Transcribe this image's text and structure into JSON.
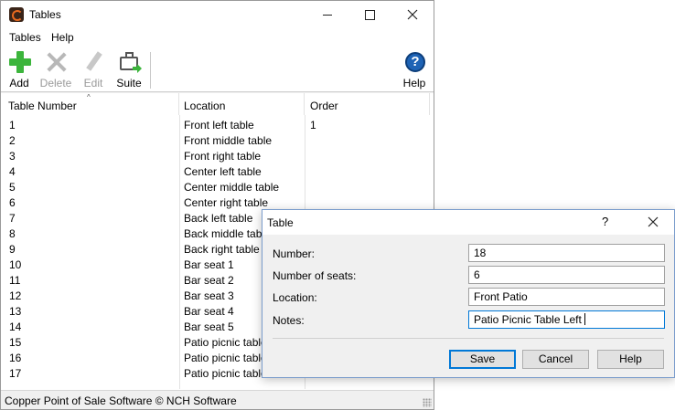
{
  "window": {
    "title": "Tables",
    "menu": [
      "Tables",
      "Help"
    ],
    "toolbar": {
      "add": "Add",
      "delete": "Delete",
      "edit": "Edit",
      "suite": "Suite",
      "help": "Help"
    },
    "columns": [
      "Table Number",
      "Location",
      "Order"
    ],
    "rows": [
      {
        "number": "1",
        "location": "Front left table",
        "order": "1"
      },
      {
        "number": "2",
        "location": "Front middle table",
        "order": ""
      },
      {
        "number": "3",
        "location": "Front right table",
        "order": ""
      },
      {
        "number": "4",
        "location": "Center left table",
        "order": ""
      },
      {
        "number": "5",
        "location": "Center middle table",
        "order": ""
      },
      {
        "number": "6",
        "location": "Center right table",
        "order": ""
      },
      {
        "number": "7",
        "location": "Back left table",
        "order": ""
      },
      {
        "number": "8",
        "location": "Back middle table",
        "order": ""
      },
      {
        "number": "9",
        "location": "Back right table",
        "order": ""
      },
      {
        "number": "10",
        "location": "Bar seat 1",
        "order": ""
      },
      {
        "number": "11",
        "location": "Bar seat 2",
        "order": ""
      },
      {
        "number": "12",
        "location": "Bar seat 3",
        "order": ""
      },
      {
        "number": "13",
        "location": "Bar seat 4",
        "order": ""
      },
      {
        "number": "14",
        "location": "Bar seat 5",
        "order": ""
      },
      {
        "number": "15",
        "location": "Patio picnic table",
        "order": ""
      },
      {
        "number": "16",
        "location": "Patio picnic table",
        "order": ""
      },
      {
        "number": "17",
        "location": "Patio picnic table",
        "order": ""
      }
    ],
    "status": "Copper Point of Sale Software © NCH Software"
  },
  "dialog": {
    "title": "Table",
    "help_glyph": "?",
    "fields": {
      "number": {
        "label": "Number:",
        "value": "18"
      },
      "seats": {
        "label": "Number of seats:",
        "value": "6"
      },
      "location": {
        "label": "Location:",
        "value": "Front Patio"
      },
      "notes": {
        "label": "Notes:",
        "value": "Patio Picnic Table Left"
      }
    },
    "buttons": {
      "save": "Save",
      "cancel": "Cancel",
      "help": "Help"
    }
  },
  "icons": {
    "app": "copper-pos-app-icon",
    "add": "plus-icon",
    "delete": "x-icon",
    "edit": "pencil-icon",
    "suite": "suite-icon",
    "help": "help-icon"
  },
  "colors": {
    "accent": "#0078d7",
    "add_green": "#3cb53c",
    "help_blue": "#1e63b5"
  }
}
